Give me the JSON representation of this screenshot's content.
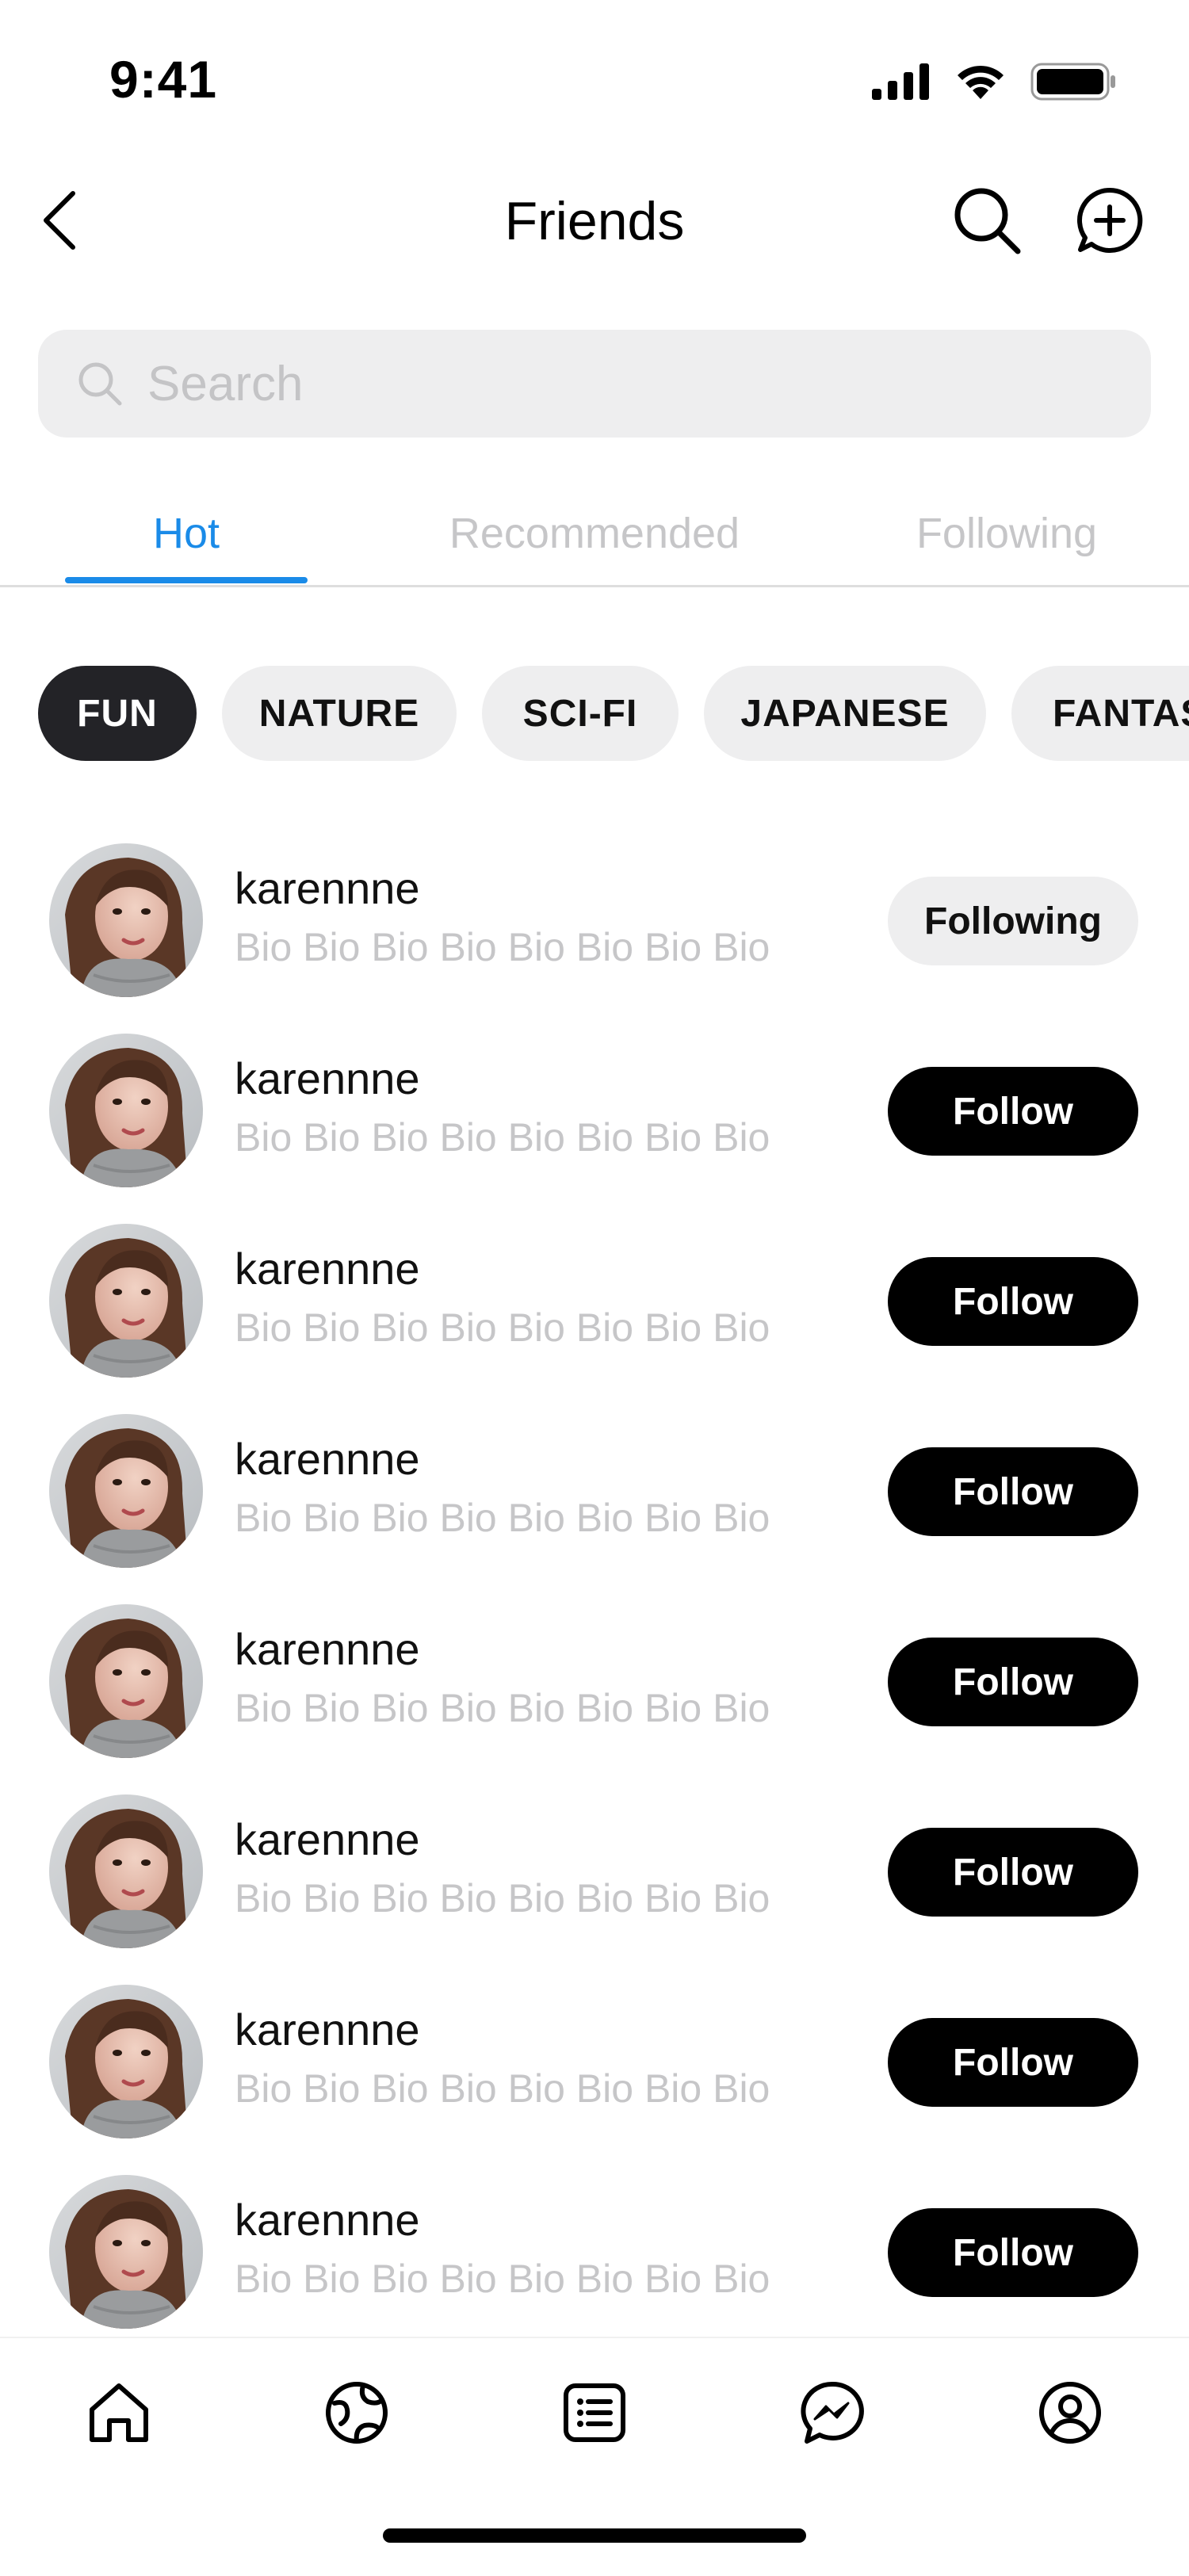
{
  "status_bar": {
    "time": "9:41"
  },
  "header": {
    "title": "Friends"
  },
  "search": {
    "placeholder": "Search",
    "value": ""
  },
  "tabs": [
    {
      "label": "Hot",
      "active": true
    },
    {
      "label": "Recommended",
      "active": false
    },
    {
      "label": "Following",
      "active": false
    }
  ],
  "chips": [
    {
      "label": "FUN",
      "active": true
    },
    {
      "label": "NATURE",
      "active": false
    },
    {
      "label": "SCI-FI",
      "active": false
    },
    {
      "label": "JAPANESE",
      "active": false
    },
    {
      "label": "FANTASY",
      "active": false
    }
  ],
  "users": [
    {
      "name": "karennne",
      "bio": "Bio Bio Bio Bio Bio Bio Bio Bio",
      "button": "Following"
    },
    {
      "name": "karennne",
      "bio": "Bio Bio Bio Bio Bio Bio Bio Bio",
      "button": "Follow"
    },
    {
      "name": "karennne",
      "bio": "Bio Bio Bio Bio Bio Bio Bio Bio",
      "button": "Follow"
    },
    {
      "name": "karennne",
      "bio": "Bio Bio Bio Bio Bio Bio Bio Bio",
      "button": "Follow"
    },
    {
      "name": "karennne",
      "bio": "Bio Bio Bio Bio Bio Bio Bio Bio",
      "button": "Follow"
    },
    {
      "name": "karennne",
      "bio": "Bio Bio Bio Bio Bio Bio Bio Bio",
      "button": "Follow"
    },
    {
      "name": "karennne",
      "bio": "Bio Bio Bio Bio Bio Bio Bio Bio",
      "button": "Follow"
    },
    {
      "name": "karennne",
      "bio": "Bio Bio Bio Bio Bio Bio Bio Bio",
      "button": "Follow"
    }
  ],
  "bottom_nav": [
    {
      "icon": "home-icon"
    },
    {
      "icon": "globe-icon"
    },
    {
      "icon": "list-icon"
    },
    {
      "icon": "messenger-icon"
    },
    {
      "icon": "profile-icon"
    }
  ],
  "colors": {
    "accent": "#1a8be8",
    "chip_active": "#232327",
    "chip_inactive": "#eeeeef",
    "follow_button": "#000000",
    "following_button": "#eeeeef",
    "muted_text": "#c6c6c8"
  }
}
